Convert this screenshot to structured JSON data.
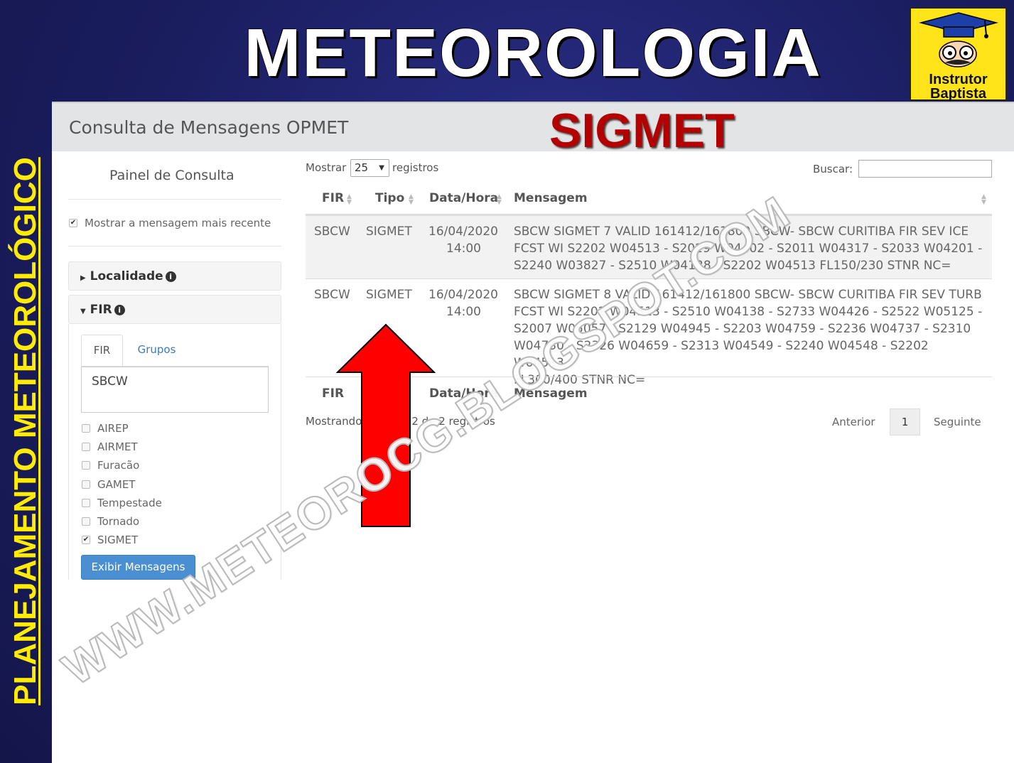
{
  "slide": {
    "title": "METEOROLOGIA",
    "side_title": "PLANEJAMENTO METEOROLÓGICO",
    "logo_line1": "Instrutor",
    "logo_line2": "Baptista",
    "overlay_label": "SIGMET",
    "watermark": "WWW.METEOROCG.BLOGSPOT.COM",
    "colors": {
      "background": "#1a1d5e",
      "side_title": "#ffec00",
      "overlay_label": "#b30000",
      "arrow": "#ff0000",
      "logo_bg": "#ffe419"
    }
  },
  "app": {
    "header_title": "Consulta de Mensagens OPMET",
    "panel": {
      "title": "Painel de Consulta",
      "recent_checkbox_label": "Mostrar a mensagem mais recente",
      "recent_checked": true,
      "localidade_label": "Localidade",
      "fir_label": "FIR",
      "tabs": {
        "fir": "FIR",
        "grupos": "Grupos"
      },
      "fir_value": "SBCW",
      "types": [
        {
          "label": "AIREP",
          "checked": false
        },
        {
          "label": "AIRMET",
          "checked": false
        },
        {
          "label": "Furacão",
          "checked": false
        },
        {
          "label": "GAMET",
          "checked": false
        },
        {
          "label": "Tempestade",
          "checked": false
        },
        {
          "label": "Tornado",
          "checked": false
        },
        {
          "label": "SIGMET",
          "checked": true
        }
      ],
      "submit_label": "Exibir Mensagens"
    },
    "table": {
      "show_label": "Mostrar",
      "page_size": "25",
      "records_label": "registros",
      "search_label": "Buscar:",
      "search_value": "",
      "columns": [
        "FIR",
        "Tipo",
        "Data/Hora",
        "Mensagem"
      ],
      "rows": [
        {
          "fir": "SBCW",
          "tipo": "SIGMET",
          "date": "16/04/2020",
          "time": "14:00",
          "msg_lines": [
            "SBCW SIGMET 7 VALID 161412/161800 SBCW- SBCW CURITIBA FIR SEV ICE",
            "FCST WI S2202 W04513 - S2029 W04402 - S2011 W04317 - S2033 W04201 -",
            "S2240 W03827 - S2510 W04138 - S2202 W04513 FL150/230 STNR NC="
          ]
        },
        {
          "fir": "SBCW",
          "tipo": "SIGMET",
          "date": "16/04/2020",
          "time": "14:00",
          "msg_lines": [
            "SBCW SIGMET 8 VALID 161412/161800 SBCW- SBCW CURITIBA FIR SEV TURB",
            "FCST WI S2202 W04513 - S2510 W04138 - S2733 W04426 - S2522 W05125 -",
            "S2007 W05057 - S2129 W04945 - S2203 W04759 - S2236 W04737 - S2310",
            "W04730 - S2326 W04659 - S2313 W04549 - S2240 W04548 - S2202 W04513",
            "FL300/400 STNR NC="
          ]
        }
      ],
      "footer_columns": [
        "FIR",
        "Data/Hora",
        "Mensagem"
      ],
      "showing_prefix": "Mostrando",
      "showing_suffix": "2 de 2 registros",
      "pagination": {
        "prev": "Anterior",
        "page": "1",
        "next": "Seguinte"
      }
    }
  }
}
